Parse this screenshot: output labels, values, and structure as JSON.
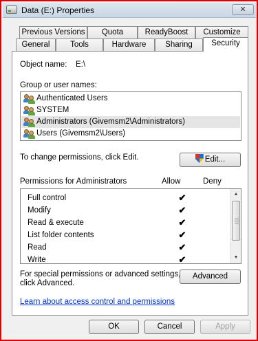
{
  "window": {
    "title": "Data (E:) Properties",
    "close_glyph": "✕"
  },
  "tabs_row1": [
    {
      "label": "Previous Versions"
    },
    {
      "label": "Quota"
    },
    {
      "label": "ReadyBoost"
    },
    {
      "label": "Customize"
    }
  ],
  "tabs_row2": [
    {
      "label": "General"
    },
    {
      "label": "Tools"
    },
    {
      "label": "Hardware"
    },
    {
      "label": "Sharing"
    },
    {
      "label": "Security",
      "active": true
    }
  ],
  "security": {
    "object_name_label": "Object name:",
    "object_name_value": "E:\\",
    "groups_label": "Group or user names:",
    "users": [
      {
        "name": "Authenticated Users"
      },
      {
        "name": "SYSTEM"
      },
      {
        "name": "Administrators (Givemsm2\\Administrators)",
        "selected": true
      },
      {
        "name": "Users (Givemsm2\\Users)"
      }
    ],
    "change_hint": "To change permissions, click Edit.",
    "edit_button": "Edit...",
    "permissions_header": "Permissions for Administrators",
    "allow_header": "Allow",
    "deny_header": "Deny",
    "permissions": [
      {
        "name": "Full control",
        "allow": "✔"
      },
      {
        "name": "Modify",
        "allow": "✔"
      },
      {
        "name": "Read & execute",
        "allow": "✔"
      },
      {
        "name": "List folder contents",
        "allow": "✔"
      },
      {
        "name": "Read",
        "allow": "✔"
      },
      {
        "name": "Write",
        "allow": "✔"
      }
    ],
    "advanced_hint_line1": "For special permissions or advanced settings,",
    "advanced_hint_line2": "click Advanced.",
    "advanced_button": "Advanced",
    "learn_link": "Learn about access control and permissions"
  },
  "footer": {
    "ok": "OK",
    "cancel": "Cancel",
    "apply": "Apply"
  },
  "icons": {
    "title": "drive-icon",
    "users": "user-group-icon",
    "edit": "uac-shield-icon",
    "check": "checkmark-icon"
  },
  "colors": {
    "frame_border": "#e00000",
    "link": "#0033cc",
    "selection": "#e5e5e5"
  }
}
